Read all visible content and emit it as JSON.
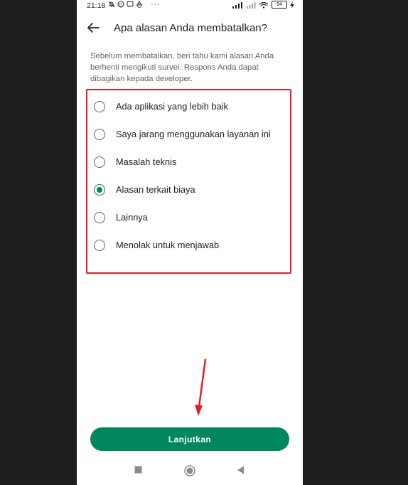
{
  "status_bar": {
    "time": "21:18",
    "more": "···",
    "battery": "64",
    "icons": [
      "muted-bell-icon",
      "data-saver-icon",
      "message-icon",
      "recycle-icon"
    ]
  },
  "header": {
    "title": "Apa alasan Anda membatalkan?"
  },
  "description": "Sebelum membatalkan, beri tahu kami alasan Anda berhenti mengikuti survei. Respons Anda dapat dibagikan kepada developer.",
  "options": [
    {
      "label": "Ada aplikasi yang lebih baik",
      "checked": false
    },
    {
      "label": "Saya jarang menggunakan layanan ini",
      "checked": false
    },
    {
      "label": "Masalah teknis",
      "checked": false
    },
    {
      "label": "Alasan terkait biaya",
      "checked": true
    },
    {
      "label": "Lainnya",
      "checked": false
    },
    {
      "label": "Menolak untuk menjawab",
      "checked": false
    }
  ],
  "cta_label": "Lanjutkan",
  "colors": {
    "accent": "#01875f",
    "annotation": "#e31e24"
  }
}
